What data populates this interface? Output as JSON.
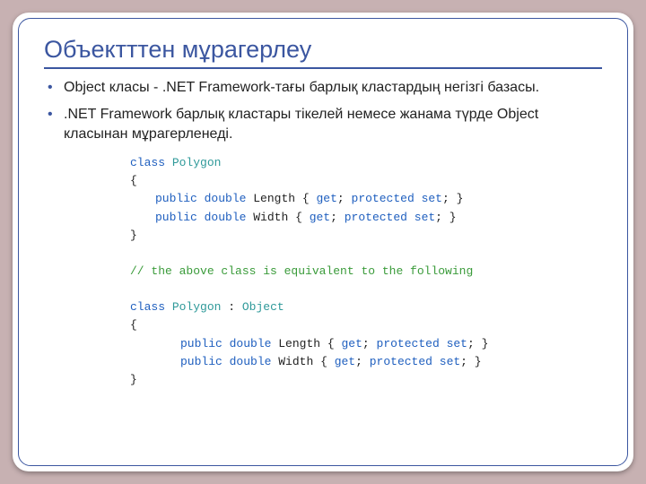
{
  "slide": {
    "title": "Объектттен мұрагерлеу",
    "bullets": [
      "Object класы - .NET Framework-тағы барлық кластардың негізгі базасы.",
      ".NET Framework барлық кластары тікелей немесе жанама түрде Object класынан мұрагерленеді."
    ],
    "code": {
      "kw_class": "class",
      "kw_public": "public",
      "kw_double": "double",
      "kw_get": "get",
      "kw_protected": "protected",
      "kw_set": "set",
      "type_polygon": "Polygon",
      "type_object": "Object",
      "prop_length": "Length",
      "prop_width": "Width",
      "comment": "// the above class is equivalent to the following",
      "brace_open": "{",
      "brace_close": "}",
      "colon": ":",
      "accessor_open": "{",
      "accessor_close": "}",
      "semi": ";"
    }
  }
}
